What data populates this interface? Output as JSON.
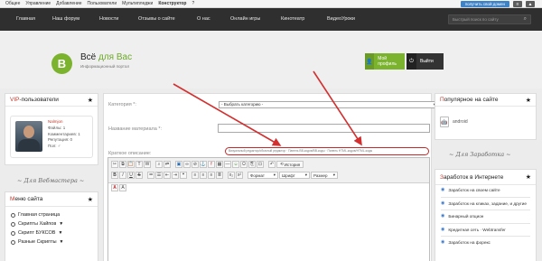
{
  "adminbar": {
    "items": [
      "Общее",
      "Управление",
      "Добавление",
      "Пользователи",
      "Мультипледжи",
      "Конструктор",
      "?"
    ],
    "get_site": "получить свой домен",
    "mini_buttons": [
      "≡",
      "▲"
    ]
  },
  "nav": {
    "items": [
      "Главная",
      "Наш форум",
      "Новости",
      "Отзывы о сайте",
      "О нас",
      "Онлайн игры",
      "Кинотеатр",
      "ВидеоУроки"
    ],
    "search_placeholder": "Быстрый поиск по сайту"
  },
  "header": {
    "logo_letter": "B",
    "title_part1": "Всё",
    "title_part2": "для Вас",
    "subtitle": "Информационный портал",
    "profile_label": "Мой профиль",
    "logout_label": "Выйти"
  },
  "vip": {
    "title_hl": "VIP",
    "title_rest": "-пользователи",
    "user": {
      "name": "Nalmjon",
      "files": "Файлы: 1",
      "comments": "Комментариев: 1",
      "reputation": "Репутация: 0",
      "gender": "Пол: ♂"
    }
  },
  "dividers": {
    "webmaster": "Для Вебмастера",
    "earnings": "Для Заработка"
  },
  "menu": {
    "title_hl": "М",
    "title_rest": "еню сайта",
    "items": [
      "Главная страница",
      "Скрипты Хайпов",
      "Скрипт БУКСОВ",
      "Разные Скрипты"
    ]
  },
  "form": {
    "category_label": "Категория *:",
    "category_value": "- Выбрать категорию -",
    "material_label": "Название материала *:",
    "short_label": "Краткое описание:",
    "hint": "Визуальный редактор/обычный редактор · Панель BB-кодов/BB-коды · Панель HTML-кодов/HTML-коды"
  },
  "editor": {
    "history_label": "История",
    "format_label": "Формат",
    "font_label": "Шрифт",
    "size_label": "Размер"
  },
  "popular": {
    "title_hl": "П",
    "title_rest": "опулярное на сайте",
    "item": "android"
  },
  "earn": {
    "title_hl": "З",
    "title_rest": "аработок в Интернете",
    "items": [
      "Заработок на своем сайте",
      "Заработок на кликах, задание, и другие",
      "Бинарный опцион",
      "Кредитная сеть · Webtransfer",
      "Заработок на форекс"
    ]
  }
}
